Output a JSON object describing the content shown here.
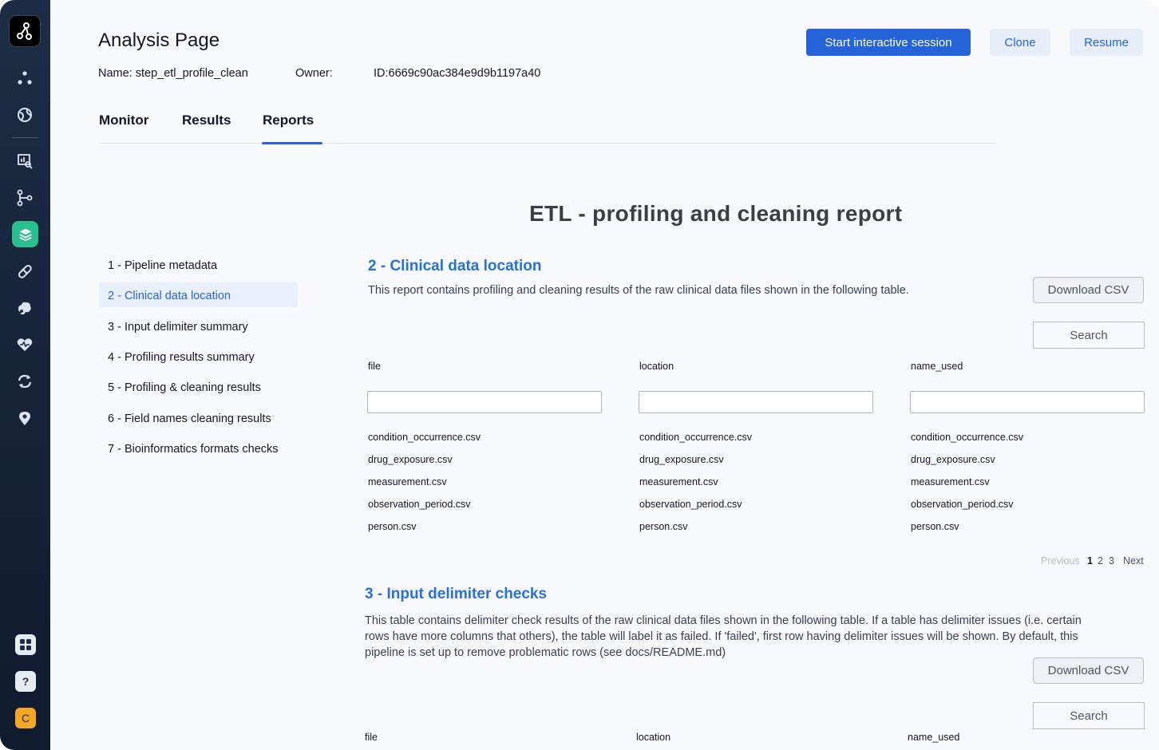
{
  "header": {
    "title": "Analysis Page",
    "name": "Name: step_etl_profile_clean",
    "owner": "Owner:",
    "id": "ID:6669c90ac384e9d9b1197a40",
    "actions": {
      "start": "Start interactive session",
      "clone": "Clone",
      "resume": "Resume"
    }
  },
  "tabs": [
    "Monitor",
    "Results",
    "Reports"
  ],
  "active_tab": "Reports",
  "report": {
    "title": "ETL - profiling and cleaning report",
    "toc": [
      "1 - Pipeline metadata",
      "2 - Clinical data location",
      "3 - Input delimiter summary",
      "4 - Profiling results summary",
      "5 - Profiling & cleaning results",
      "6 - Field names cleaning results",
      "7 - Bioinformatics formats checks"
    ],
    "section2": {
      "title": "2 - Clinical data location",
      "description": "This report contains profiling and cleaning results of the raw clinical data files shown in the following table.",
      "download": "Download CSV",
      "search": "Search",
      "columns": [
        "file",
        "location",
        "name_used"
      ],
      "rows": [
        [
          "condition_occurrence.csv",
          "condition_occurrence.csv",
          "condition_occurrence.csv"
        ],
        [
          "drug_exposure.csv",
          "drug_exposure.csv",
          "drug_exposure.csv"
        ],
        [
          "measurement.csv",
          "measurement.csv",
          "measurement.csv"
        ],
        [
          "observation_period.csv",
          "observation_period.csv",
          "observation_period.csv"
        ],
        [
          "person.csv",
          "person.csv",
          "person.csv"
        ]
      ],
      "pager": {
        "previous": "Previous",
        "pages": [
          "1",
          "2",
          "3"
        ],
        "current": "1",
        "next": "Next"
      }
    },
    "section3": {
      "title": "3 - Input delimiter checks",
      "description_lines": [
        "This table contains delimiter check results of the raw clinical data files shown in the following table. If a table has delimiter issues (i.e. certain",
        "rows have more columns that others), the table will label it as failed. If 'failed', first row having delimiter issues will be shown. By default, this",
        "pipeline is set up to remove problematic rows (see docs/README.md)"
      ],
      "download": "Download CSV",
      "search": "Search",
      "columns": [
        "file",
        "location",
        "name_used"
      ]
    }
  },
  "sidebar": {
    "icons": [
      "network-icon",
      "globe-icon",
      "chart-search-icon",
      "git-branch-icon",
      "layers-icon",
      "pill-icon",
      "brain-icon",
      "heart-icon",
      "sync-icon",
      "location-pin-icon"
    ],
    "bottom": {
      "apps_icon": "grid-icon",
      "help": "?",
      "user_initial": "C"
    },
    "colors": {
      "active": "#27c08e",
      "user_badge": "#f5a623"
    }
  },
  "colors": {
    "accent": "#2563d9",
    "section_title": "#2870d6"
  }
}
